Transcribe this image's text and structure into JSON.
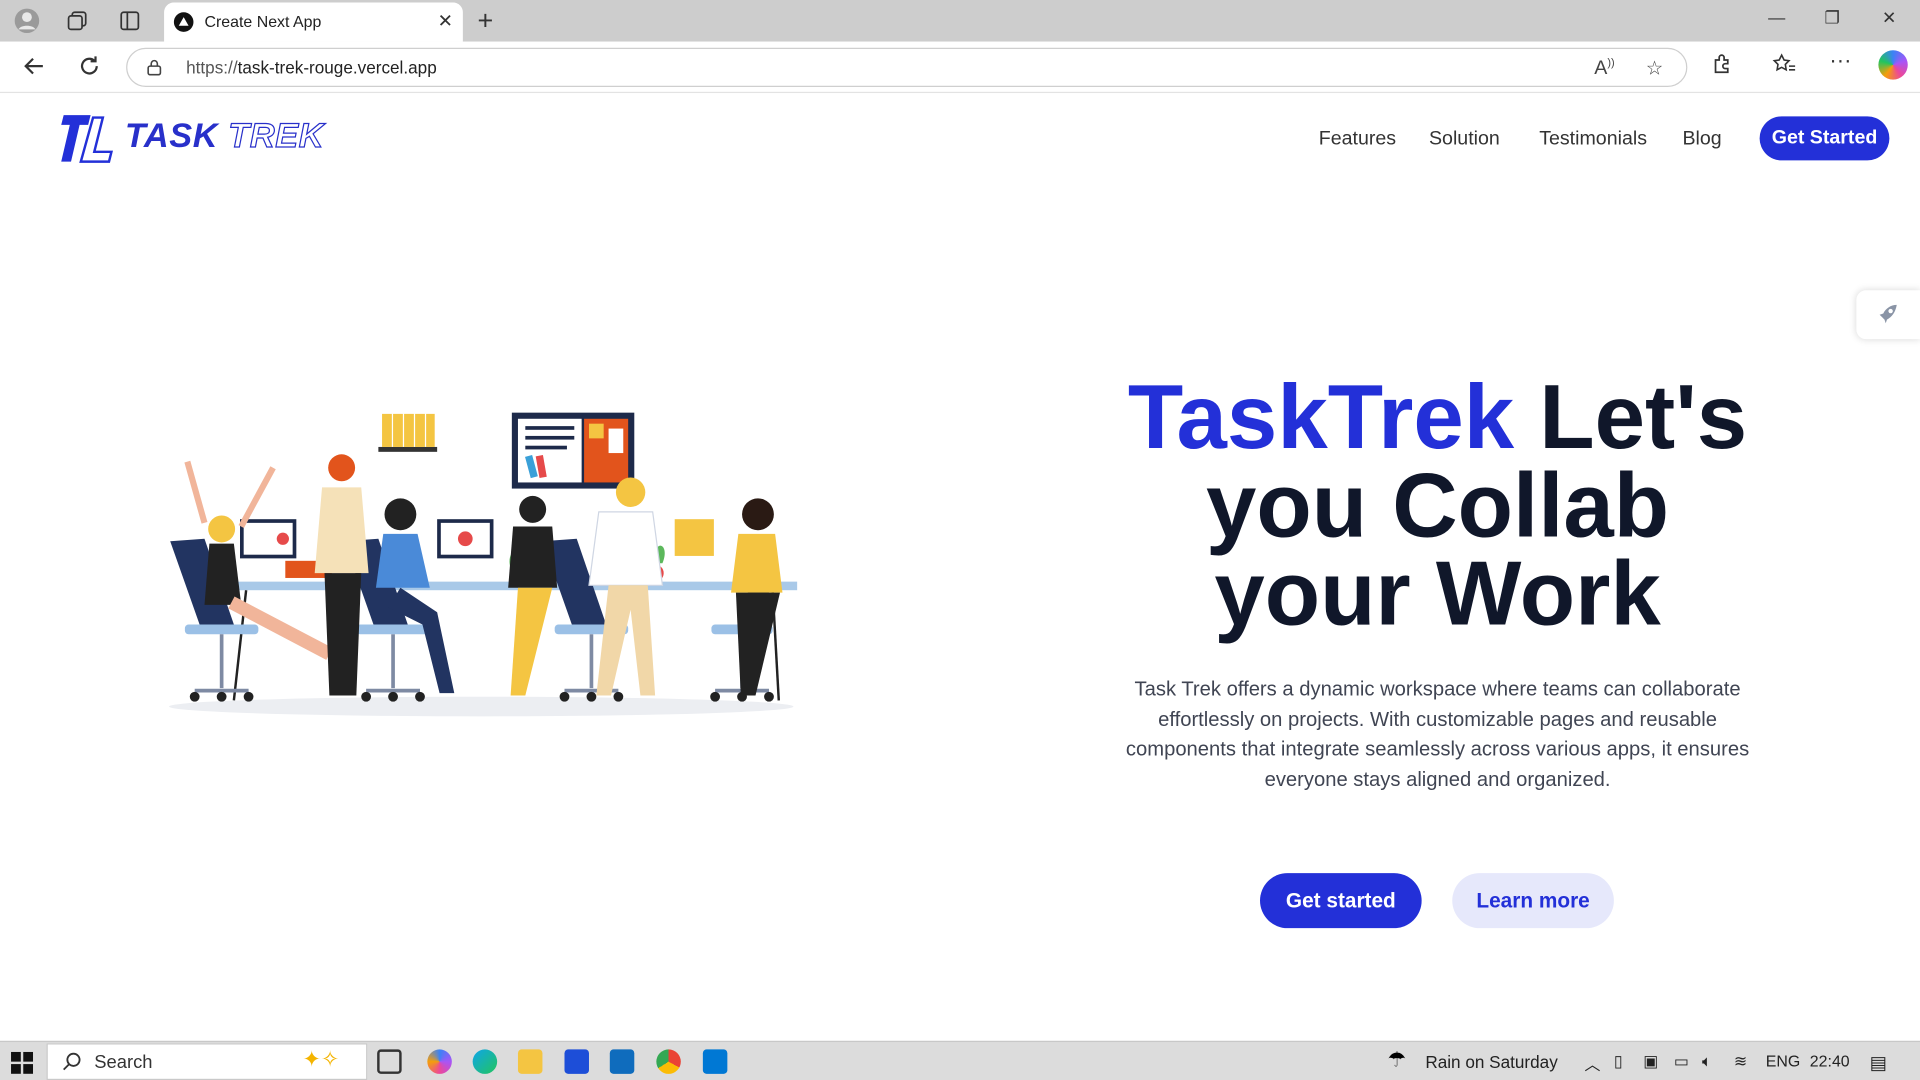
{
  "browser": {
    "tab_title": "Create Next App",
    "url_scheme": "https://",
    "url_host": "task-trek-rouge.vercel.app"
  },
  "site": {
    "logo_text_1": "TASK",
    "logo_text_2": "TREK",
    "nav": [
      "Features",
      "Solution",
      "Testimonials",
      "Blog"
    ],
    "cta_label": "Get Started"
  },
  "hero": {
    "title_brand": "TaskTrek",
    "title_rest": "Let's you Collab your Work",
    "description": "Task Trek offers a dynamic workspace where teams can collaborate effortlessly on projects. With customizable pages and reusable components that integrate seamlessly across various apps, it ensures everyone stays aligned and organized.",
    "primary_button": "Get started",
    "secondary_button": "Learn more"
  },
  "taskbar": {
    "search_label": "Search",
    "weather": "Rain on Saturday",
    "language": "ENG",
    "time": "22:40"
  },
  "colors": {
    "brand": "#2330d8",
    "heading": "#10172a",
    "secondary_bg": "#e6e8fb"
  }
}
